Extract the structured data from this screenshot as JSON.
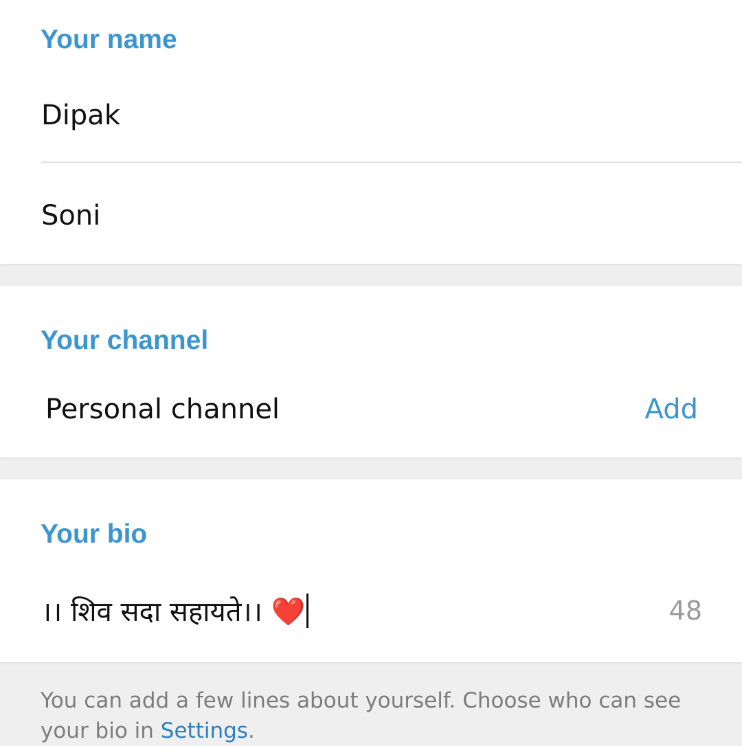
{
  "name_section": {
    "header": "Your name",
    "first_name": "Dipak",
    "last_name": "Soni"
  },
  "channel_section": {
    "header": "Your channel",
    "label": "Personal channel",
    "add_label": "Add"
  },
  "bio_section": {
    "header": "Your bio",
    "bio_text": "।। शिव सदा सहायते।। ❤️",
    "char_counter": "48"
  },
  "footer": {
    "text": "You can add a few lines about yourself. Choose who can see your bio in ",
    "link": "Settings",
    "end": "."
  },
  "colors": {
    "accent": "#3d95cf",
    "background": "#efefef",
    "surface": "#ffffff"
  }
}
